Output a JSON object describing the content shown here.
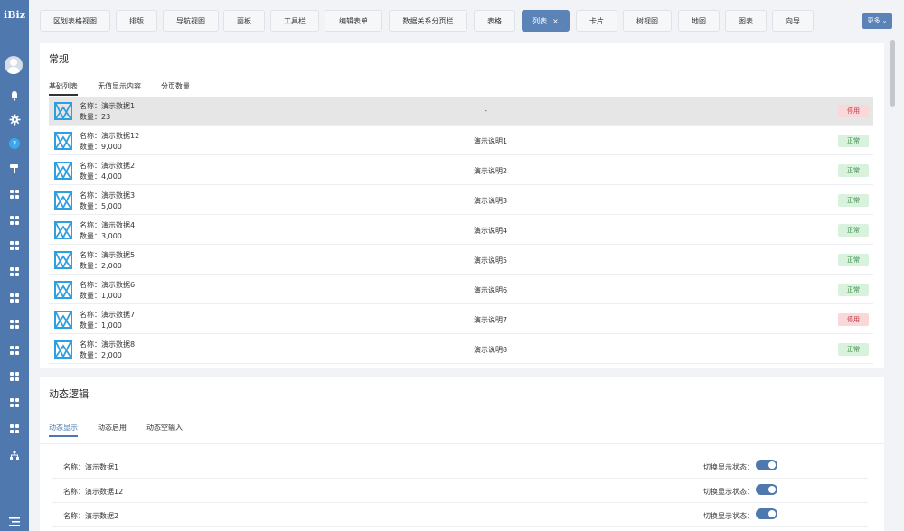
{
  "app": {
    "logo": "iBiz"
  },
  "tabs": [
    {
      "label": "区划表格视图"
    },
    {
      "label": "排版"
    },
    {
      "label": "导航视图"
    },
    {
      "label": "面板"
    },
    {
      "label": "工具栏"
    },
    {
      "label": "编辑表单"
    },
    {
      "label": "数据关系分页栏"
    },
    {
      "label": "表格"
    },
    {
      "label": "列表",
      "active": true,
      "close": "×"
    },
    {
      "label": "卡片"
    },
    {
      "label": "树视图"
    },
    {
      "label": "地图"
    },
    {
      "label": "图表"
    },
    {
      "label": "向导"
    }
  ],
  "more_button": "更多 ⌄",
  "section1": {
    "title": "常规",
    "subtabs": [
      "基础列表",
      "无值显示内容",
      "分页数量"
    ],
    "rows": [
      {
        "name": "名称：演示数据1",
        "qty": "数量：23",
        "desc": "-",
        "status": "停用",
        "type": "stop",
        "selected": true
      },
      {
        "name": "名称：演示数据12",
        "qty": "数量：9,000",
        "desc": "演示说明1",
        "status": "正常",
        "type": "ok"
      },
      {
        "name": "名称：演示数据2",
        "qty": "数量：4,000",
        "desc": "演示说明2",
        "status": "正常",
        "type": "ok"
      },
      {
        "name": "名称：演示数据3",
        "qty": "数量：5,000",
        "desc": "演示说明3",
        "status": "正常",
        "type": "ok"
      },
      {
        "name": "名称：演示数据4",
        "qty": "数量：3,000",
        "desc": "演示说明4",
        "status": "正常",
        "type": "ok"
      },
      {
        "name": "名称：演示数据5",
        "qty": "数量：2,000",
        "desc": "演示说明5",
        "status": "正常",
        "type": "ok"
      },
      {
        "name": "名称：演示数据6",
        "qty": "数量：1,000",
        "desc": "演示说明6",
        "status": "正常",
        "type": "ok"
      },
      {
        "name": "名称：演示数据7",
        "qty": "数量：1,000",
        "desc": "演示说明7",
        "status": "停用",
        "type": "stop"
      },
      {
        "name": "名称：演示数据8",
        "qty": "数量：2,000",
        "desc": "演示说明8",
        "status": "正常",
        "type": "ok"
      }
    ]
  },
  "section2": {
    "title": "动态逻辑",
    "subtabs": [
      "动态显示",
      "动态启用",
      "动态空输入"
    ],
    "rows": [
      {
        "name": "名称：演示数据1",
        "switch_label": "切换显示状态：",
        "on": true
      },
      {
        "name": "名称：演示数据12",
        "switch_label": "切换显示状态：",
        "on": true
      },
      {
        "name": "名称：演示数据2",
        "switch_label": "切换显示状态：",
        "on": true
      }
    ]
  },
  "colors": {
    "sidebar": "#4e78ae",
    "accent": "#5b83b8",
    "ok_bg": "#d9f2dd",
    "stop_bg": "#f8d8da"
  }
}
